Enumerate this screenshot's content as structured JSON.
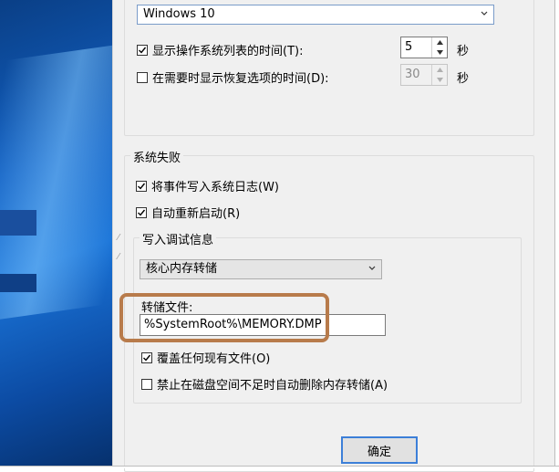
{
  "os_select": {
    "value": "Windows 10"
  },
  "os_list_time": {
    "label": "显示操作系统列表的时间(T):",
    "checked": true,
    "value": "5",
    "unit": "秒"
  },
  "recovery_time": {
    "label": "在需要时显示恢复选项的时间(D):",
    "checked": false,
    "value": "30",
    "unit": "秒"
  },
  "system_failure": {
    "legend": "系统失败",
    "write_event": {
      "label": "将事件写入系统日志(W)",
      "checked": true
    },
    "auto_restart": {
      "label": "自动重新启动(R)",
      "checked": true
    },
    "debug_info": {
      "legend": "写入调试信息",
      "select_value": "核心内存转储",
      "dump_file_label": "转储文件:",
      "dump_file_value": "%SystemRoot%\\MEMORY.DMP",
      "overwrite": {
        "label": "覆盖任何现有文件(O)",
        "checked": true
      },
      "disable_auto_delete": {
        "label": "禁止在磁盘空间不足时自动删除内存转储(A)",
        "checked": false
      }
    }
  },
  "ok_button": {
    "label": "确定"
  },
  "colors": {
    "highlight": "#b87b4b",
    "accent": "#3c7fd8"
  }
}
